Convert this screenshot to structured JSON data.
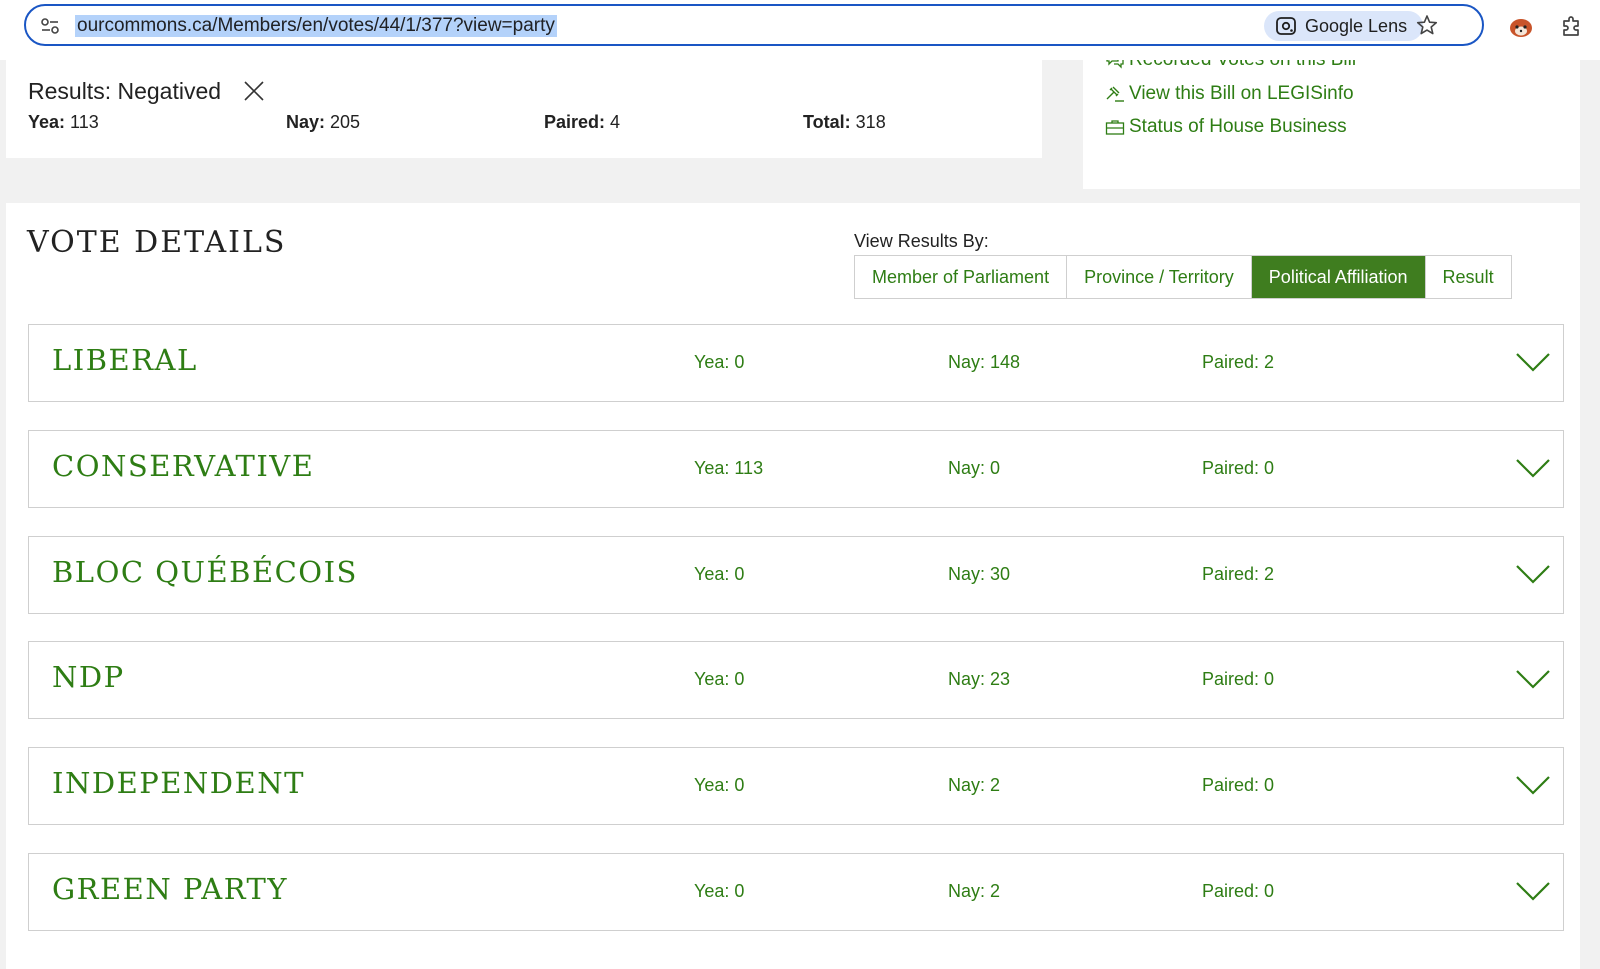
{
  "browser": {
    "url": "ourcommons.ca/Members/en/votes/44/1/377?view=party",
    "lens_label": "Google Lens"
  },
  "results": {
    "heading": "Results: Negatived",
    "yea_label": "Yea:",
    "yea_value": "113",
    "nay_label": "Nay:",
    "nay_value": "205",
    "paired_label": "Paired:",
    "paired_value": "4",
    "total_label": "Total:",
    "total_value": "318"
  },
  "side_links": [
    {
      "label": "Recorded Votes on this Bill"
    },
    {
      "label": "View this Bill on LEGISinfo"
    },
    {
      "label": "Status of House Business"
    }
  ],
  "details": {
    "title": "VOTE DETAILS",
    "view_label": "View Results By:",
    "tabs": [
      {
        "label": "Member of Parliament",
        "active": false
      },
      {
        "label": "Province / Territory",
        "active": false
      },
      {
        "label": "Political Affiliation",
        "active": true
      },
      {
        "label": "Result",
        "active": false
      }
    ],
    "parties": [
      {
        "name": "LIBERAL",
        "yea": "Yea: 0",
        "nay": "Nay: 148",
        "paired": "Paired: 2"
      },
      {
        "name": "CONSERVATIVE",
        "yea": "Yea: 113",
        "nay": "Nay: 0",
        "paired": "Paired: 0"
      },
      {
        "name": "BLOC QUÉBÉCOIS",
        "yea": "Yea: 0",
        "nay": "Nay: 30",
        "paired": "Paired: 2"
      },
      {
        "name": "NDP",
        "yea": "Yea: 0",
        "nay": "Nay: 23",
        "paired": "Paired: 0"
      },
      {
        "name": "INDEPENDENT",
        "yea": "Yea: 0",
        "nay": "Nay: 2",
        "paired": "Paired: 0"
      },
      {
        "name": "GREEN PARTY",
        "yea": "Yea: 0",
        "nay": "Nay: 2",
        "paired": "Paired: 0"
      }
    ]
  },
  "colors": {
    "accent_green": "#2e7d14",
    "active_tab": "#3f7d1f",
    "omnibox_border": "#1a56c4",
    "url_highlight": "#b4d2fa"
  },
  "icons": {
    "site_info": "tune-icon",
    "lens": "google-lens-icon",
    "bookmark": "star-icon",
    "extension": "red-panda-icon",
    "extensions_menu": "puzzle-icon",
    "negatived": "close-x-icon",
    "row_toggle": "chevron-down-icon"
  }
}
